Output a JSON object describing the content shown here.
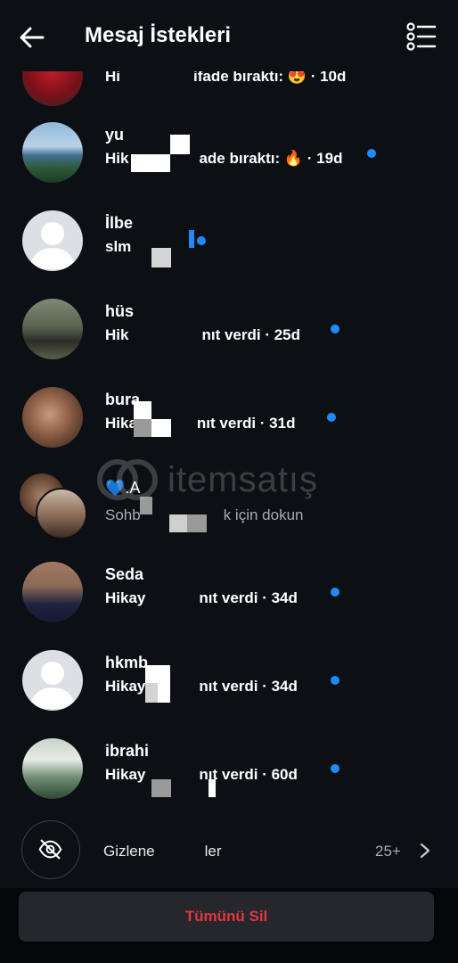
{
  "header": {
    "title": "Mesaj İstekleri"
  },
  "requests": [
    {
      "name": "",
      "subtitle": "Hi",
      "subtitle_tail": "ifade bıraktı: 😍 · 10d",
      "unread": false
    },
    {
      "name": "yu",
      "subtitle": "Hik",
      "subtitle_tail": "ade bıraktı: 🔥 · 19d",
      "unread": true
    },
    {
      "name": "İlbe",
      "subtitle": "slm",
      "unread": true
    },
    {
      "name": "hüs",
      "subtitle": "Hik",
      "subtitle_tail": "nıt verdi · 25d",
      "unread": true
    },
    {
      "name": "bura",
      "subtitle": "Hika",
      "subtitle_tail": "nıt verdi · 31d",
      "unread": true
    },
    {
      "name": "💙.A",
      "subtitle": "Sohb",
      "subtitle_tail": "k için dokun",
      "unread": false
    },
    {
      "name": "Seda",
      "subtitle": "Hikay",
      "subtitle_tail": "nıt verdi · 34d",
      "unread": true
    },
    {
      "name": "hkmb",
      "subtitle": "Hikay",
      "subtitle_tail": "nıt verdi · 34d",
      "unread": true
    },
    {
      "name": "ibrahi",
      "subtitle": "Hikay",
      "subtitle_tail": "nıt verdi · 60d",
      "unread": true
    }
  ],
  "hidden_requests": {
    "label_start": "Gizlene",
    "label_end": "ler",
    "count": "25+"
  },
  "footer": {
    "delete_all_label": "Tümünü Sil"
  },
  "watermark": {
    "text": "itemsatış"
  },
  "colors": {
    "background": "#0c0f14",
    "unread_dot": "#1d8cf8",
    "delete_text": "#e0383f"
  },
  "icons": [
    "back-arrow-icon",
    "filter-list-icon",
    "eye-off-icon",
    "chevron-right-icon"
  ]
}
